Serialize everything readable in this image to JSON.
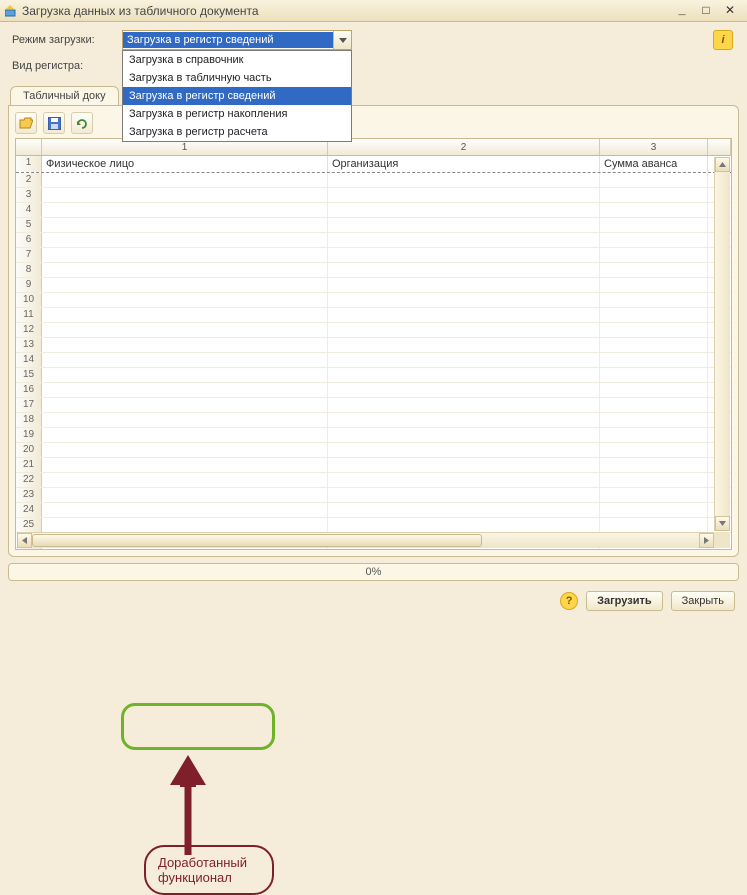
{
  "window": {
    "title": "Загрузка данных из табличного документа"
  },
  "fields": {
    "mode_label": "Режим загрузки:",
    "mode_value": "Загрузка в регистр сведений",
    "register_label": "Вид регистра:"
  },
  "dropdown": {
    "items": [
      {
        "label": "Загрузка в справочник",
        "selected": false
      },
      {
        "label": "Загрузка в табличную часть",
        "selected": false
      },
      {
        "label": "Загрузка в регистр сведений",
        "selected": true
      },
      {
        "label": "Загрузка в регистр накопления",
        "selected": false
      },
      {
        "label": "Загрузка в регистр расчета",
        "selected": false
      }
    ]
  },
  "tabs": {
    "tabular_doc": "Табличный доку"
  },
  "grid": {
    "col_headers": [
      "1",
      "2",
      "3"
    ],
    "field_headers": [
      "Физическое лицо",
      "Организация",
      "Сумма аванса"
    ],
    "row_count": 27
  },
  "progress": {
    "text": "0%"
  },
  "footer": {
    "load": "Загрузить",
    "close": "Закрыть"
  },
  "annotation": {
    "line1": "Доработанный",
    "line2": "функционал"
  }
}
